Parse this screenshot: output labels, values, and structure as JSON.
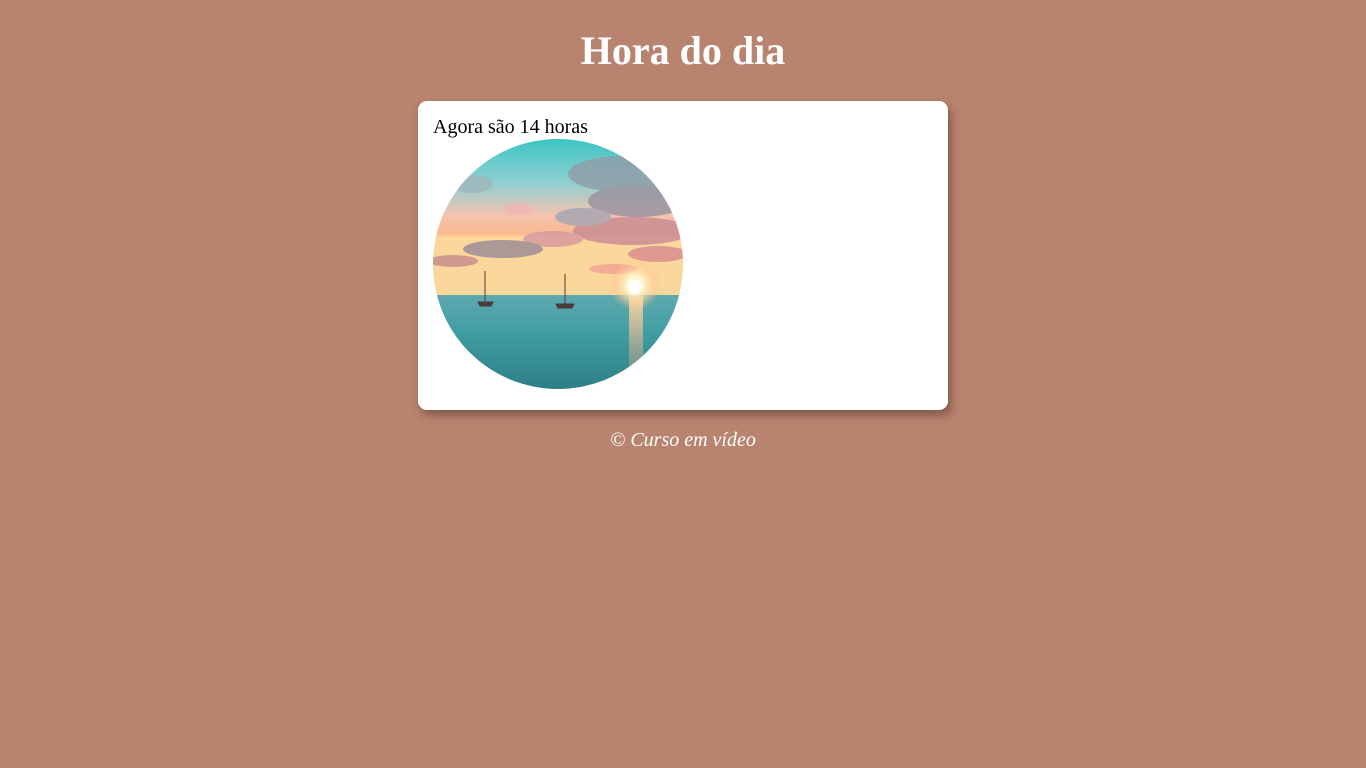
{
  "header": {
    "title": "Hora do dia"
  },
  "card": {
    "message": "Agora são 14 horas",
    "image": {
      "subject": "sunset-sea-with-sailboats-photo"
    }
  },
  "footer": {
    "text": "© Curso em vídeo"
  },
  "colors": {
    "page_background": "#b8846f",
    "card_background": "#ffffff",
    "title_text": "#ffffff",
    "footer_text": "#ffffff"
  }
}
